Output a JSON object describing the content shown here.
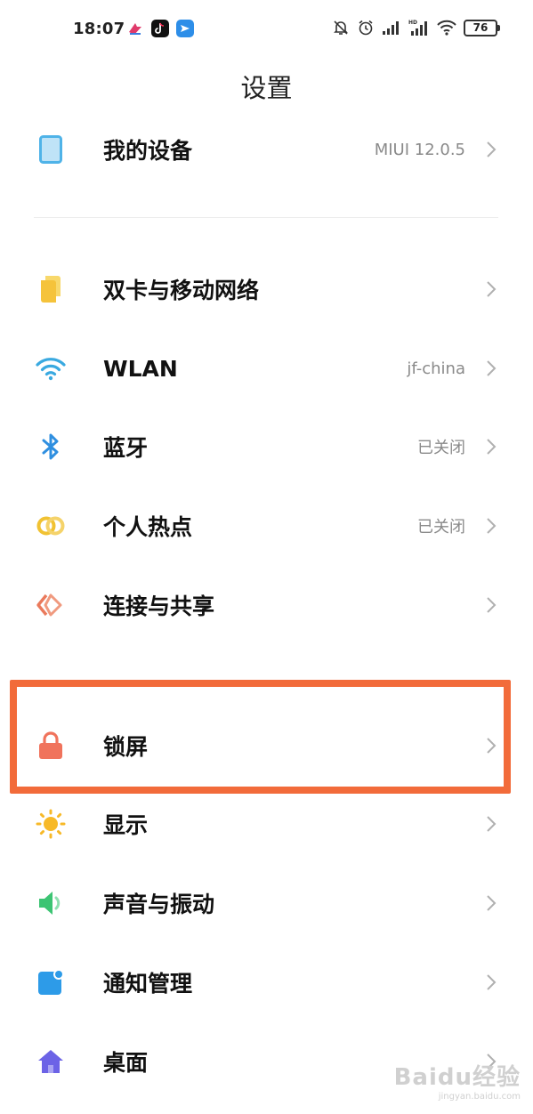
{
  "status_bar": {
    "time": "18:07",
    "battery": "76",
    "notification_icons": [
      "app-notification-icon",
      "tiktok-icon",
      "message-icon"
    ],
    "system_icons": [
      "mute-icon",
      "alarm-icon",
      "signal-icon",
      "hd-signal-icon",
      "wifi-icon"
    ]
  },
  "header": {
    "title": "设置"
  },
  "rows": [
    {
      "id": "my-device",
      "label": "我的设备",
      "value": "MIUI 12.0.5",
      "icon": "tablet-icon"
    },
    {
      "id": "sim-network",
      "label": "双卡与移动网络",
      "value": "",
      "icon": "sim-card-icon"
    },
    {
      "id": "wlan",
      "label": "WLAN",
      "value": "jf-china",
      "icon": "wifi-icon"
    },
    {
      "id": "bluetooth",
      "label": "蓝牙",
      "value": "已关闭",
      "icon": "bluetooth-icon"
    },
    {
      "id": "hotspot",
      "label": "个人热点",
      "value": "已关闭",
      "icon": "hotspot-icon"
    },
    {
      "id": "connection-share",
      "label": "连接与共享",
      "value": "",
      "icon": "connection-share-icon"
    },
    {
      "id": "lock-screen",
      "label": "锁屏",
      "value": "",
      "icon": "lock-icon"
    },
    {
      "id": "display",
      "label": "显示",
      "value": "",
      "icon": "sun-icon"
    },
    {
      "id": "sound-vibration",
      "label": "声音与振动",
      "value": "",
      "icon": "speaker-icon"
    },
    {
      "id": "notifications",
      "label": "通知管理",
      "value": "",
      "icon": "notification-icon"
    },
    {
      "id": "desktop",
      "label": "桌面",
      "value": "",
      "icon": "home-icon"
    }
  ],
  "highlight": {
    "target": "lock-screen",
    "color": "#f26b3a"
  },
  "watermark": {
    "main": "Baidu经验",
    "sub": "jingyan.baidu.com"
  },
  "colors": {
    "device": "#4fb3e8",
    "sim": "#f5c33b",
    "wifi": "#39a9e0",
    "bluetooth": "#2f8fe0",
    "hotspot": "#f1c232",
    "share": "#ea7a5c",
    "lock": "#f0735c",
    "display": "#f7b928",
    "sound": "#3cc473",
    "notify": "#2d9be8",
    "home": "#6c63e6"
  }
}
